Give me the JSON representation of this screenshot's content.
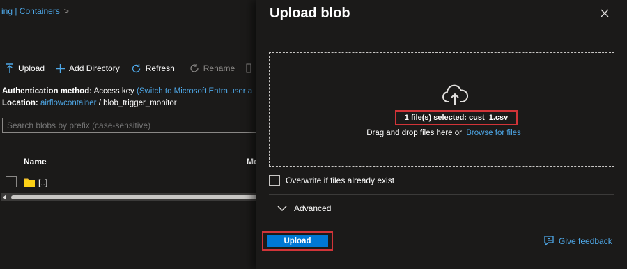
{
  "left": {
    "breadcrumb": {
      "text": "ing | Containers",
      "chevron": ">"
    },
    "toolbar": {
      "upload": "Upload",
      "add_directory": "Add Directory",
      "refresh": "Refresh",
      "rename": "Rename"
    },
    "info": {
      "auth_label": "Authentication method:",
      "auth_value": "Access key",
      "auth_link": "(Switch to Microsoft Entra user a",
      "location_label": "Location:",
      "location_link": "airflowcontainer",
      "location_path": "/  blob_trigger_monitor"
    },
    "search": {
      "placeholder": "Search blobs by prefix (case-sensitive)"
    },
    "table": {
      "col_name": "Name",
      "col_modified": "Mo",
      "rows": [
        {
          "name": "[..]",
          "icon": "folder-icon"
        }
      ]
    }
  },
  "panel": {
    "title": "Upload blob",
    "dropzone": {
      "selected": "1 file(s) selected: cust_1.csv",
      "drag_text": "Drag and drop files here  or",
      "browse": "Browse for files"
    },
    "overwrite_label": "Overwrite if files already exist",
    "advanced_label": "Advanced",
    "upload_button": "Upload",
    "feedback": "Give feedback"
  },
  "colors": {
    "background": "#1b1a19",
    "accent": "#0078d4",
    "link": "#4ea8e8",
    "highlight": "#d13438"
  }
}
